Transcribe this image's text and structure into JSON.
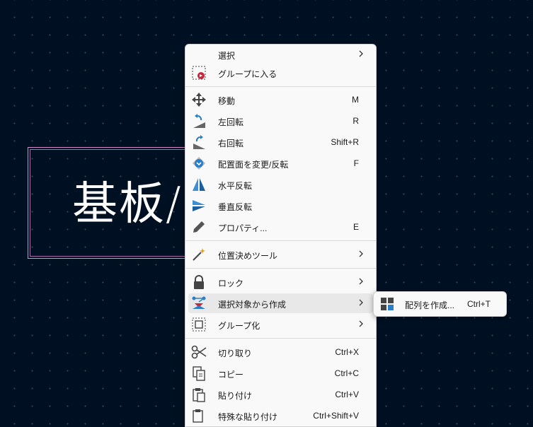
{
  "canvas": {
    "board_text": "基板/"
  },
  "menu": {
    "items": [
      {
        "label": "選択",
        "shortcut": "",
        "icon": "none",
        "submenu": true
      },
      {
        "label": "グループに入る",
        "shortcut": "",
        "icon": "enter-group-icon"
      },
      {
        "label": "移動",
        "shortcut": "M",
        "icon": "move-icon"
      },
      {
        "label": "左回転",
        "shortcut": "R",
        "icon": "rotate-left-icon"
      },
      {
        "label": "右回転",
        "shortcut": "Shift+R",
        "icon": "rotate-right-icon"
      },
      {
        "label": "配置面を変更/反転",
        "shortcut": "F",
        "icon": "flip-board-icon"
      },
      {
        "label": "水平反転",
        "shortcut": "",
        "icon": "mirror-horizontal-icon"
      },
      {
        "label": "垂直反転",
        "shortcut": "",
        "icon": "mirror-vertical-icon"
      },
      {
        "label": "プロパティ...",
        "shortcut": "E",
        "icon": "properties-icon"
      },
      {
        "label": "位置決めツール",
        "shortcut": "",
        "icon": "positioning-tools-icon",
        "submenu": true
      },
      {
        "label": "ロック",
        "shortcut": "",
        "icon": "lock-icon",
        "submenu": true
      },
      {
        "label": "選択対象から作成",
        "shortcut": "",
        "icon": "create-from-selection-icon",
        "submenu": true
      },
      {
        "label": "グループ化",
        "shortcut": "",
        "icon": "group-icon",
        "submenu": true
      },
      {
        "label": "切り取り",
        "shortcut": "Ctrl+X",
        "icon": "cut-icon"
      },
      {
        "label": "コピー",
        "shortcut": "Ctrl+C",
        "icon": "copy-icon"
      },
      {
        "label": "貼り付け",
        "shortcut": "Ctrl+V",
        "icon": "paste-icon"
      },
      {
        "label": "特殊な貼り付け",
        "shortcut": "Ctrl+Shift+V",
        "icon": "paste-special-icon"
      }
    ]
  },
  "submenu": {
    "label": "配列を作成...",
    "shortcut": "Ctrl+T",
    "icon": "array-icon"
  }
}
